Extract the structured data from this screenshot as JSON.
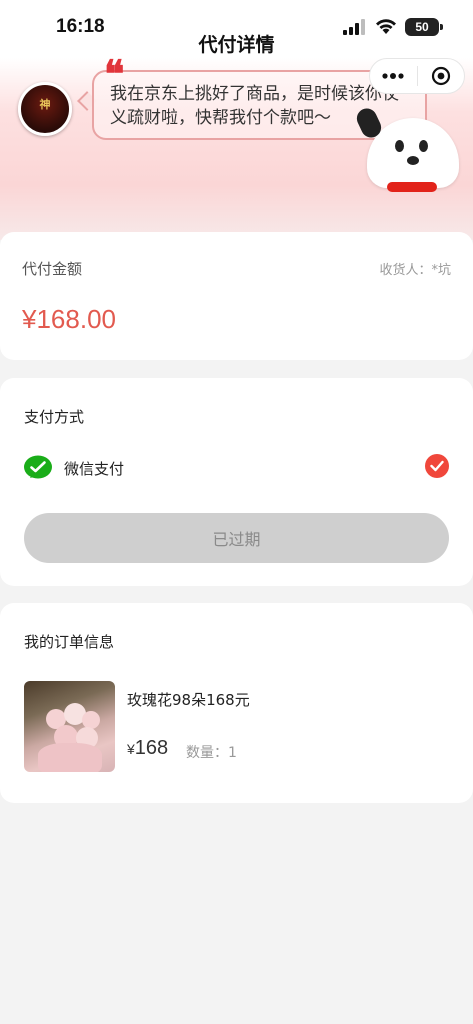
{
  "status_bar": {
    "time": "16:18",
    "battery": "50"
  },
  "nav": {
    "title": "代付详情"
  },
  "banner": {
    "message": "我在京东上挑好了商品，是时候该你仗义疏财啦，快帮我付个款吧～",
    "avatar_text": "神"
  },
  "amount_card": {
    "label": "代付金额",
    "receiver": "收货人：*坑",
    "amount": "¥168.00"
  },
  "payment_card": {
    "title": "支付方式",
    "method": "微信支付",
    "button": "已过期"
  },
  "order_card": {
    "title": "我的订单信息",
    "product_name": "玫瑰花98朵168元",
    "currency": "¥",
    "price": "168",
    "quantity": "数量：1"
  },
  "colors": {
    "accent": "#e25a4f",
    "check": "#f0473b",
    "wechat": "#1aad19",
    "button_disabled": "#cfcfcf"
  }
}
